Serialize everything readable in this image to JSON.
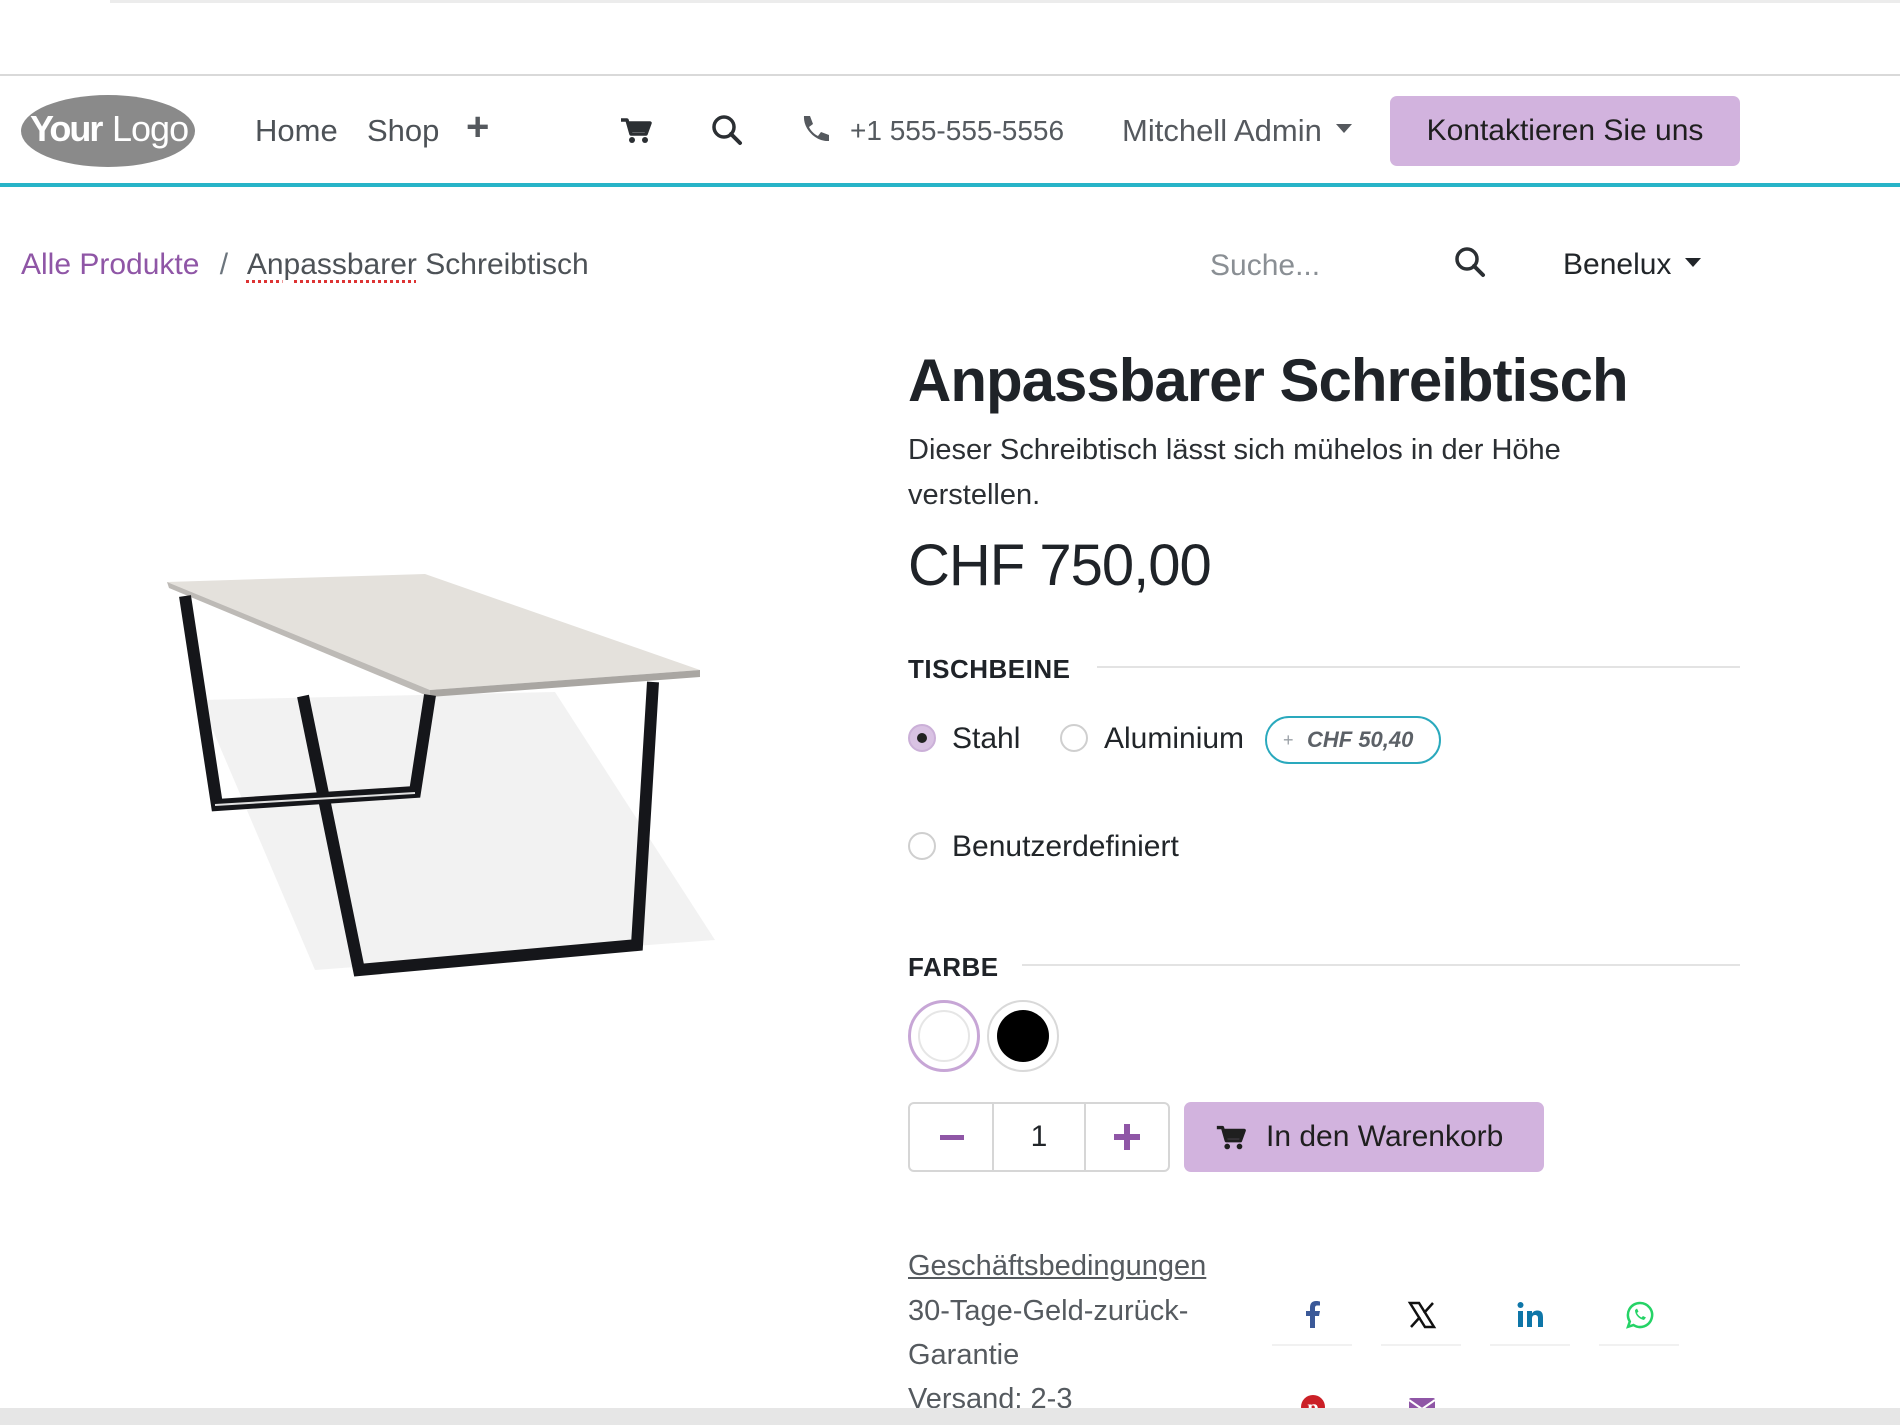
{
  "navbar": {
    "logo_text": "YourLogo",
    "links": [
      "Home",
      "Shop"
    ],
    "plus": "+",
    "phone": "+1 555-555-5556",
    "user": "Mitchell Admin",
    "contact_button": "Kontaktieren Sie uns"
  },
  "breadcrumb": {
    "parent": "Alle Produkte",
    "separator": "/",
    "current_underlined": "Anpassbarer",
    "current_rest": " Schreibtisch"
  },
  "search": {
    "placeholder": "Suche..."
  },
  "region": "Benelux",
  "product": {
    "title": "Anpassbarer Schreibtisch",
    "description": "Dieser Schreibtisch lässt sich mühelos in der Höhe verstellen.",
    "price": "CHF 750,00",
    "legs_label": "TISCHBEINE",
    "legs_options": [
      {
        "label": "Stahl",
        "selected": true
      },
      {
        "label": "Aluminium",
        "selected": false,
        "extra": "CHF 50,40"
      },
      {
        "label": "Benutzerdefiniert",
        "selected": false
      }
    ],
    "color_label": "FARBE",
    "colors": [
      {
        "name": "white",
        "hex": "#ffffff",
        "selected": true
      },
      {
        "name": "black",
        "hex": "#000000",
        "selected": false
      }
    ],
    "quantity": "1",
    "add_to_cart": "In den Warenkorb"
  },
  "info": {
    "terms_link": "Geschäftsbedingungen",
    "guarantee": "30-Tage-Geld-zurück-Garantie",
    "shipping": "Versand: 2-3"
  },
  "share_icons": [
    "facebook-icon",
    "x-icon",
    "linkedin-icon",
    "whatsapp-icon",
    "pinterest-icon",
    "email-icon"
  ],
  "colors": {
    "accent": "#8f56a6",
    "button_bg": "#d2b3de",
    "navbar_border": "#27b4c8"
  }
}
